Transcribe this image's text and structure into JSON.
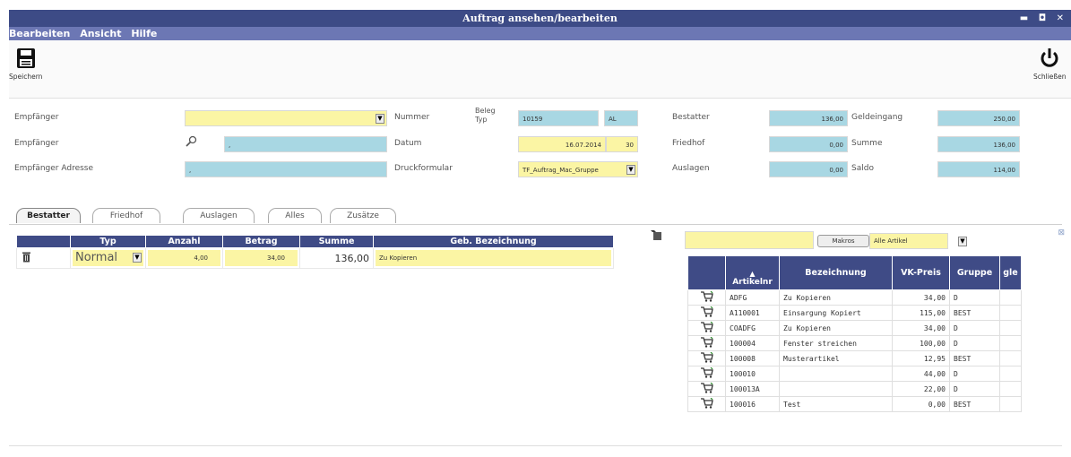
{
  "window": {
    "title": "Auftrag ansehen/bearbeiten",
    "controls": "▬ ◘ ✕"
  },
  "menu": [
    "Bearbeiten",
    "Ansicht",
    "Hilfe"
  ],
  "toolbar": {
    "save_label": "Speichern",
    "close_label": "Schließen"
  },
  "header": {
    "empfaenger_label": "Empfänger",
    "empfaenger2_label": "Empfänger",
    "empfaenger_value": ",",
    "adresse_label": "Empfänger Adresse",
    "adresse_value": ",",
    "nummer_label": "Nummer",
    "beleg_label": "Beleg",
    "typ_label": "Typ",
    "nummer_value": "10159",
    "typ_value": "AL",
    "datum_label": "Datum",
    "datum_value": "16.07.2014",
    "datum_extra": "30",
    "druck_label": "Druckformular",
    "druck_value": "TF_Auftrag_Mac_Gruppe",
    "bestatter_label": "Bestatter",
    "bestatter_value": "136,00",
    "friedhof_label": "Friedhof",
    "friedhof_value": "0,00",
    "auslagen_label": "Auslagen",
    "auslagen_value": "0,00",
    "geldeingang_label": "Geldeingang",
    "geldeingang_value": "250,00",
    "summe_label": "Summe",
    "summe_value": "136,00",
    "saldo_label": "Saldo",
    "saldo_value": "114,00"
  },
  "tabs": [
    "Bestatter",
    "Friedhof",
    "Auslagen",
    "Alles",
    "Zusätze"
  ],
  "positions": {
    "headers": [
      "Typ",
      "Anzahl",
      "Betrag",
      "Summe",
      "Geb. Bezeichnung"
    ],
    "row": {
      "typ": "Normal",
      "anzahl": "4,00",
      "betrag": "34,00",
      "summe": "136,00",
      "bezeichnung": "Zu Kopieren"
    }
  },
  "articles": {
    "makros_label": "Makros",
    "filter_value": "Alle Artikel",
    "headers": [
      "Artikelnr",
      "Bezeichnung",
      "VK-Preis",
      "Gruppe",
      "gle"
    ],
    "rows": [
      {
        "nr": "ADFG",
        "bez": "Zu Kopieren",
        "preis": "34,00",
        "gruppe": "D"
      },
      {
        "nr": "A110001",
        "bez": "Einsargung Kopiert",
        "preis": "115,00",
        "gruppe": "BEST"
      },
      {
        "nr": "COADFG",
        "bez": "Zu Kopieren",
        "preis": "34,00",
        "gruppe": "D"
      },
      {
        "nr": "100004",
        "bez": "Fenster streichen",
        "preis": "100,00",
        "gruppe": "D"
      },
      {
        "nr": "100008",
        "bez": "Musterartikel",
        "preis": "12,95",
        "gruppe": "BEST"
      },
      {
        "nr": "100010",
        "bez": "",
        "preis": "44,00",
        "gruppe": "D"
      },
      {
        "nr": "100013A",
        "bez": "",
        "preis": "22,00",
        "gruppe": "D"
      },
      {
        "nr": "100016",
        "bez": "Test",
        "preis": "0,00",
        "gruppe": "BEST"
      }
    ]
  }
}
